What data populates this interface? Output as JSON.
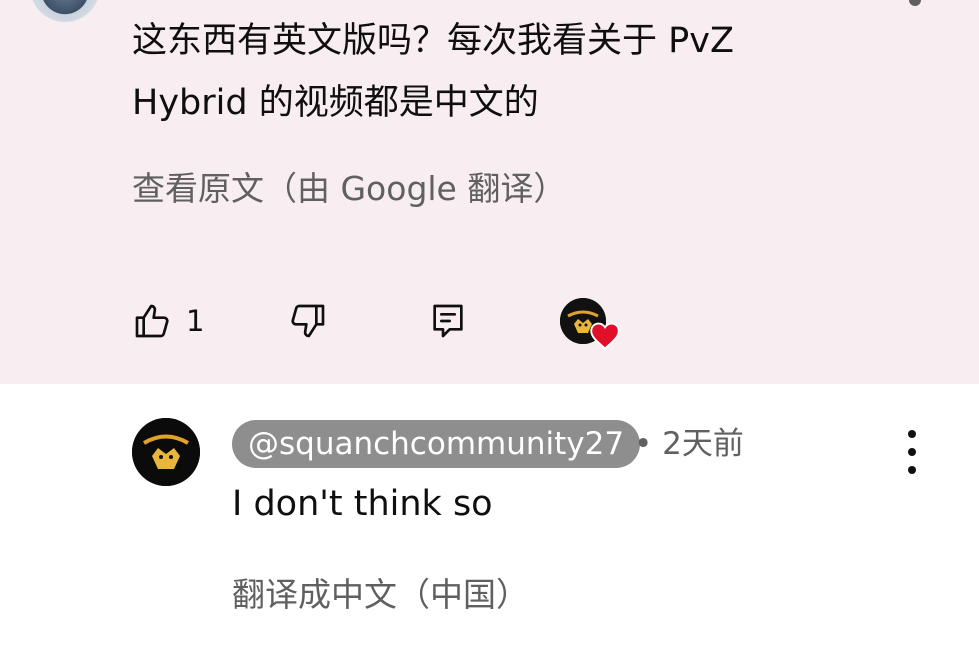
{
  "comment": {
    "text": "这东西有英文版吗？每次我看关于 PvZ\nHybrid 的视频都是中文的",
    "translate_label": "查看原文（由 Google 翻译）",
    "like_count": "1",
    "hearted": true
  },
  "reply": {
    "handle": "@squanchcommunity27",
    "separator": "•",
    "time": "2天前",
    "text": "I don't think so",
    "translate_label": "翻译成中文（中国）"
  },
  "icons": {
    "like": "thumbs-up-icon",
    "dislike": "thumbs-down-icon",
    "reply": "comment-reply-icon",
    "heart": "heart-icon",
    "menu": "more-vertical-icon"
  },
  "colors": {
    "card_background": "#f8eef2",
    "secondary_text": "#606060",
    "handle_pill": "#8e8e8e",
    "heart": "#e0102a"
  }
}
